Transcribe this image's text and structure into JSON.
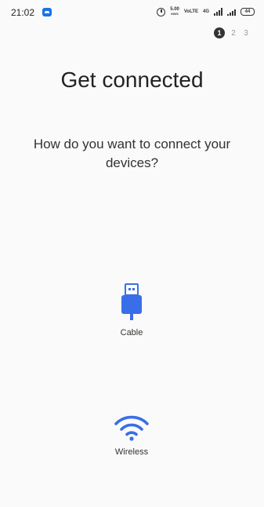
{
  "status_bar": {
    "time": "21:02",
    "network_speed": "5.00",
    "network_speed_unit": "KB/S",
    "volte": "VoLTE",
    "network_type": "4G",
    "battery": "44"
  },
  "steps": {
    "active": "1",
    "items": [
      "1",
      "2",
      "3"
    ]
  },
  "main": {
    "title": "Get connected",
    "subtitle": "How do you want to connect your devices?"
  },
  "options": {
    "cable": {
      "label": "Cable",
      "icon": "usb-icon"
    },
    "wireless": {
      "label": "Wireless",
      "icon": "wifi-icon"
    }
  },
  "colors": {
    "accent": "#3a6ee8",
    "background": "#fafafa",
    "text": "#222222"
  }
}
